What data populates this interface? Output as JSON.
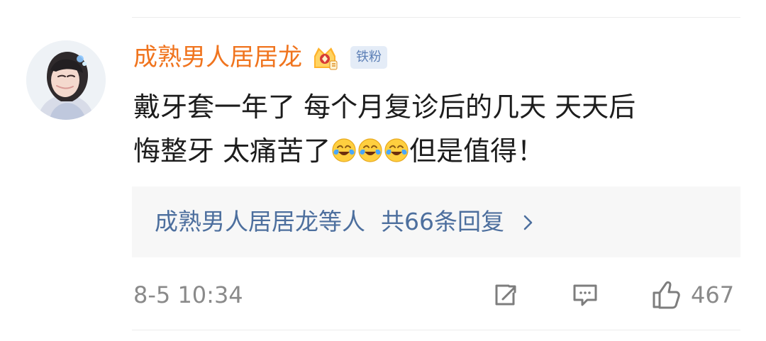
{
  "comment": {
    "author": "成熟男人居居龙",
    "badge": "铁粉",
    "text_lines": [
      "戴牙套一年了 每个月复诊后的几天 天天后",
      "悔整牙 太痛苦了",
      "但是值得！"
    ],
    "emoji_name": "laughing-crying-emoji",
    "timestamp": "8-5 10:34",
    "likes": "467"
  },
  "replies": {
    "user": "成熟男人居居龙",
    "etc": "等人",
    "count": "共66条回复"
  },
  "colors": {
    "author": "#f0741e",
    "link": "#4d6f9e",
    "meta": "#8a8a8a",
    "badge_bg": "#e4ecf7"
  }
}
